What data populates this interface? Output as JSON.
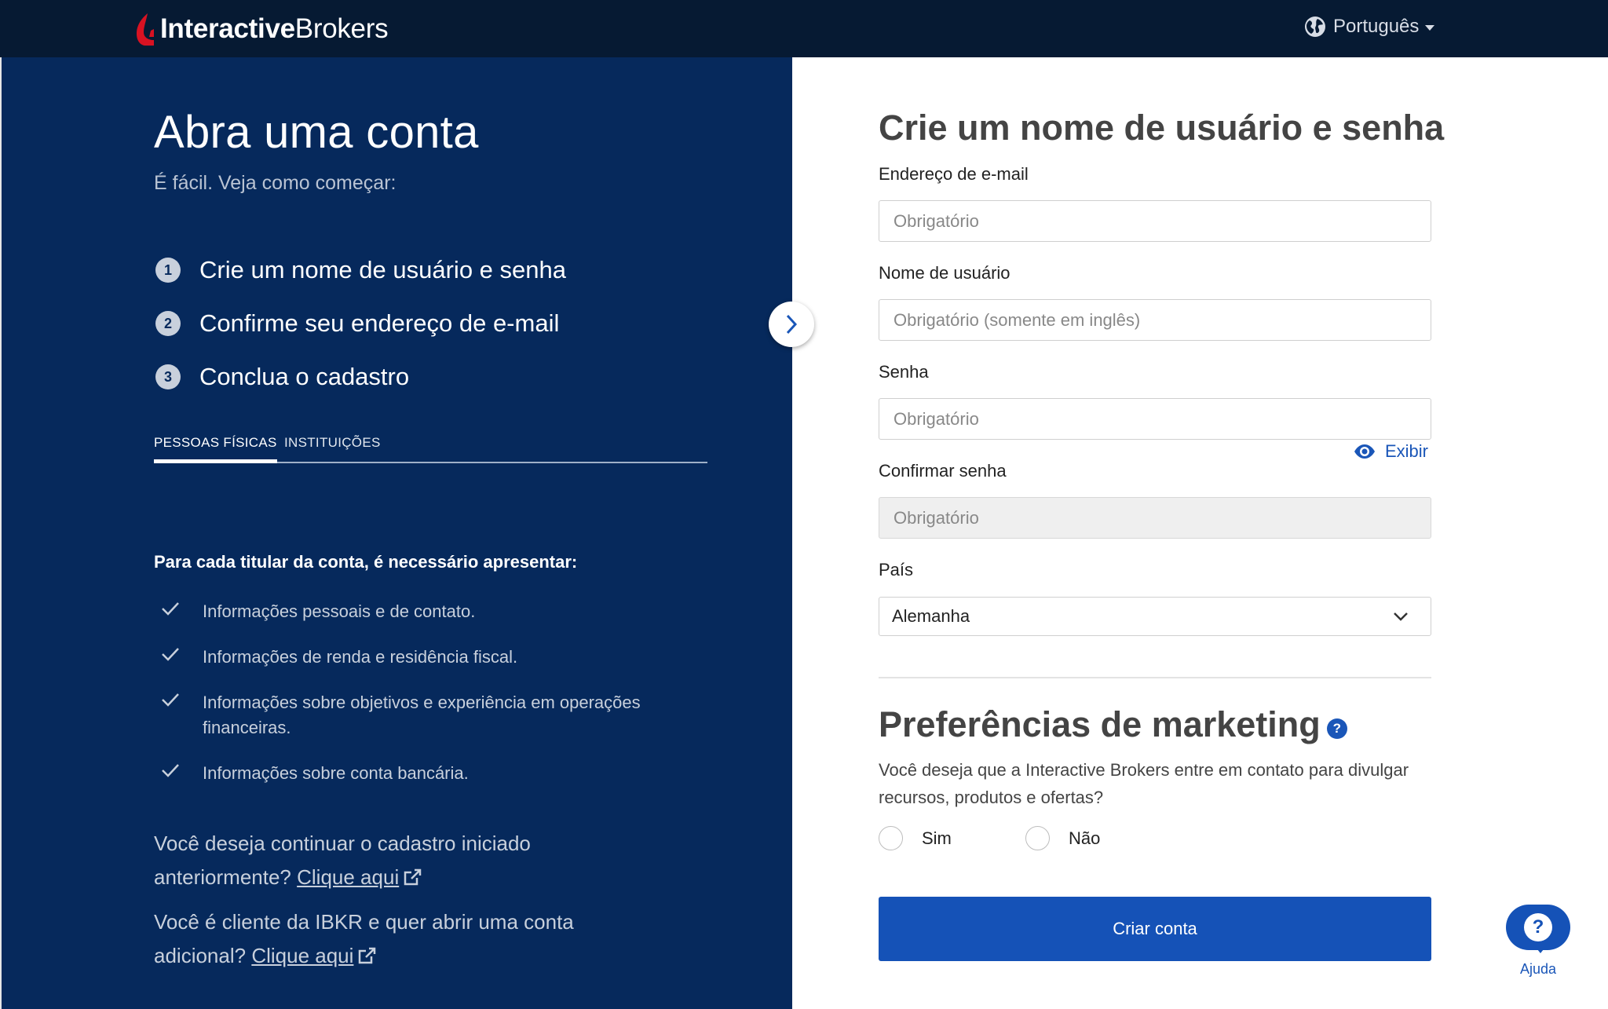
{
  "header": {
    "logo_bold": "Interactive",
    "logo_light": "Brokers",
    "language": "Português"
  },
  "left": {
    "title": "Abra uma conta",
    "subtitle": "É fácil. Veja como começar:",
    "steps": [
      {
        "num": "1",
        "label": "Crie um nome de usuário e senha"
      },
      {
        "num": "2",
        "label": "Confirme seu endereço de e-mail"
      },
      {
        "num": "3",
        "label": "Conclua o cadastro"
      }
    ],
    "tabs": {
      "individuals": "PESSOAS FÍSICAS",
      "institutions": "INSTITUIÇÕES"
    },
    "requirements_title": "Para cada titular da conta, é necessário apresentar:",
    "requirements": [
      "Informações pessoais e de contato.",
      "Informações de renda e residência fiscal.",
      "Informações sobre objetivos e experiência em operações financeiras.",
      "Informações sobre conta bancária."
    ],
    "continue_text": "Você deseja continuar o cadastro iniciado anteriormente?",
    "continue_link": "Clique aqui",
    "additional_text": "Você é cliente da IBKR e quer abrir uma conta adicional?",
    "additional_link": "Clique aqui"
  },
  "form": {
    "title": "Crie um nome de usuário e senha",
    "email_label": "Endereço de e-mail",
    "email_placeholder": "Obrigatório",
    "username_label": "Nome de usuário",
    "username_placeholder": "Obrigatório (somente em inglês)",
    "password_label": "Senha",
    "password_placeholder": "Obrigatório",
    "show_password": "Exibir",
    "confirm_label": "Confirmar senha",
    "confirm_placeholder": "Obrigatório",
    "country_label": "País",
    "country_value": "Alemanha",
    "marketing_title": "Preferências de marketing",
    "marketing_help": "?",
    "marketing_question": "Você deseja que a Interactive Brokers entre em contato para divulgar recursos, produtos e ofertas?",
    "yes": "Sim",
    "no": "Não",
    "submit": "Criar conta"
  },
  "help_widget": {
    "icon": "?",
    "label": "Ajuda"
  },
  "colors": {
    "header_bg": "#061a33",
    "panel_bg": "#06295c",
    "brand_red": "#d81222",
    "primary": "#1552b7"
  }
}
